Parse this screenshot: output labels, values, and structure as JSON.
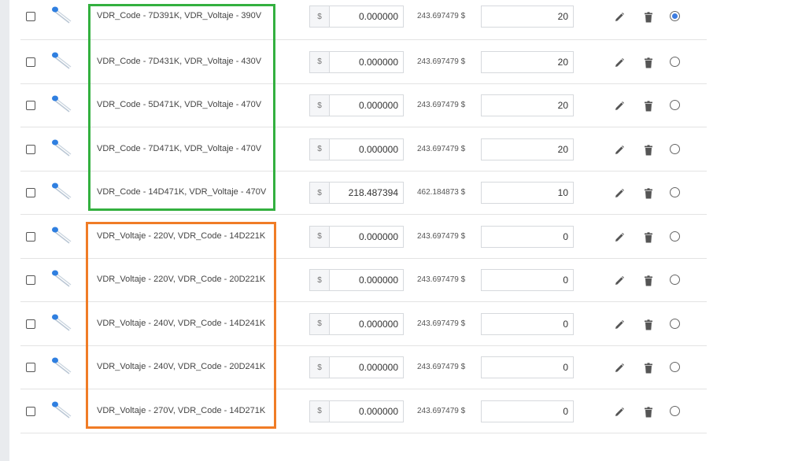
{
  "currency_symbol": "$",
  "highlight_colors": {
    "group1": "#33b03f",
    "group2": "#f07c26"
  },
  "rows": [
    {
      "name": "VDR_Code - 7D391K, VDR_Voltaje - 390V",
      "price": "0.000000",
      "total": "243.697479 $",
      "quantity": "20",
      "default": true,
      "checked": false
    },
    {
      "name": "VDR_Code - 7D431K, VDR_Voltaje - 430V",
      "price": "0.000000",
      "total": "243.697479 $",
      "quantity": "20",
      "default": false,
      "checked": false
    },
    {
      "name": "VDR_Code - 5D471K, VDR_Voltaje - 470V",
      "price": "0.000000",
      "total": "243.697479 $",
      "quantity": "20",
      "default": false,
      "checked": false
    },
    {
      "name": "VDR_Code - 7D471K, VDR_Voltaje - 470V",
      "price": "0.000000",
      "total": "243.697479 $",
      "quantity": "20",
      "default": false,
      "checked": false
    },
    {
      "name": "VDR_Code - 14D471K, VDR_Voltaje - 470V",
      "price": "218.487394",
      "total": "462.184873 $",
      "quantity": "10",
      "default": false,
      "checked": false
    },
    {
      "name": "VDR_Voltaje - 220V, VDR_Code - 14D221K",
      "price": "0.000000",
      "total": "243.697479 $",
      "quantity": "0",
      "default": false,
      "checked": false
    },
    {
      "name": "VDR_Voltaje - 220V, VDR_Code - 20D221K",
      "price": "0.000000",
      "total": "243.697479 $",
      "quantity": "0",
      "default": false,
      "checked": false
    },
    {
      "name": "VDR_Voltaje - 240V, VDR_Code - 14D241K",
      "price": "0.000000",
      "total": "243.697479 $",
      "quantity": "0",
      "default": false,
      "checked": false
    },
    {
      "name": "VDR_Voltaje - 240V, VDR_Code - 20D241K",
      "price": "0.000000",
      "total": "243.697479 $",
      "quantity": "0",
      "default": false,
      "checked": false
    },
    {
      "name": "VDR_Voltaje - 270V, VDR_Code - 14D271K",
      "price": "0.000000",
      "total": "243.697479 $",
      "quantity": "0",
      "default": false,
      "checked": false
    }
  ]
}
